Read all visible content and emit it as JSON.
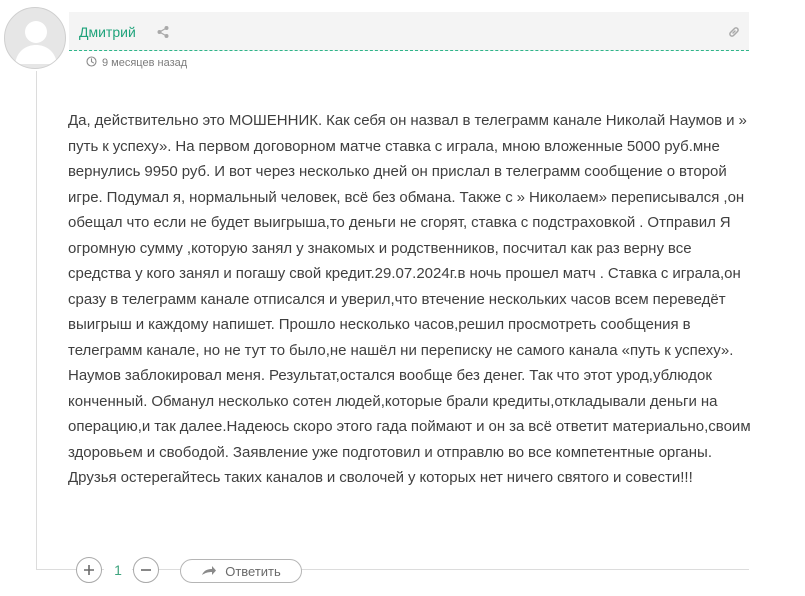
{
  "comment": {
    "author": "Дмитрий",
    "timestamp": "9 месяцев назад",
    "body": "Да, действительно это МОШЕННИК. Как себя он назвал в телеграмм канале Николай Наумов и » путь к успеху». На первом договорном матче ставка с играла, мною вложенные 5000 руб.мне вернулись 9950 руб. И вот через несколько дней он прислал в телеграмм сообщение о второй игре. Подумал я, нормальный человек, всё без обмана. Также с » Николаем» переписывался ,он обещал что если не будет выигрыша,то деньги не сгорят, ставка с подстраховкой . Отправил Я огромную сумму ,которую занял у знакомых и родственников, посчитал как раз верну все средства у кого занял и погашу свой кредит.29.07.2024г.в ночь прошел матч . Ставка с играла,он сразу в телеграмм канале отписался и уверил,что втечение нескольких часов всем переведёт выигрыш и каждому напишет. Прошло несколько часов,решил просмотреть сообщения в телеграмм канале, но не тут то было,не нашёл ни переписку не самого канала «путь к успеху». Наумов заблокировал меня. Результат,остался вообще без денег. Так что этот урод,ублюдок конченный. Обманул несколько сотен людей,которые брали кредиты,откладывали деньги на операцию,и так далее.Надеюсь скоро этого гада поймают и он за всё ответит материально,своим здоровьем и свободой. Заявление уже подготовил и отправлю во все компетентные органы. Друзья остерегайтесь таких каналов и сволочей у которых нет ничего святого и совести!!!",
    "votes": "1",
    "reply_label": "Ответить"
  },
  "icons": {
    "avatar": "user-avatar-placeholder",
    "share": "share-icon",
    "permalink": "link-icon",
    "clock": "clock-icon",
    "upvote": "plus-icon",
    "downvote": "minus-icon",
    "reply": "reply-arrow-icon"
  },
  "colors": {
    "accent": "#1fa37b",
    "text": "#3f3f3f",
    "muted": "#7d7d7d"
  }
}
